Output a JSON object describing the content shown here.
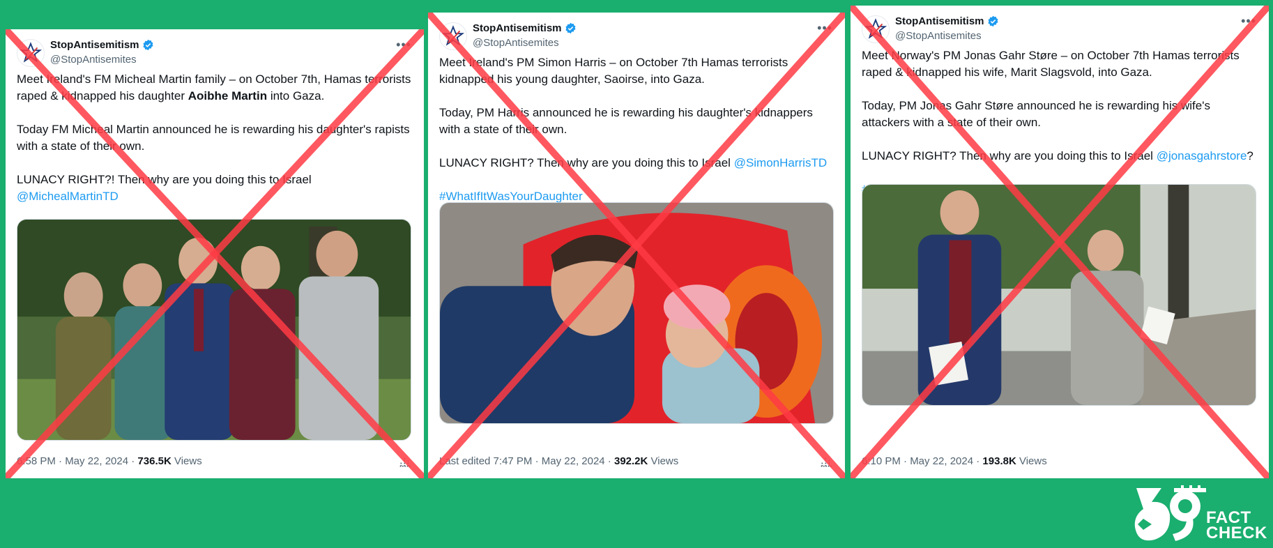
{
  "colors": {
    "background": "#1aae6f",
    "cross": "#ff3b45",
    "link": "#1d9bf0"
  },
  "tweets": [
    {
      "account_name": "StopAntisemitism",
      "handle": "@StopAntisemites",
      "more_icon": "more-icon",
      "p1_a": "Meet Ireland's FM Micheal Martin family – on October 7th, Hamas terrorists raped & kidnapped his daughter ",
      "p1_bold": "Aoibhe Martin",
      "p1_b": " into Gaza.",
      "p2": "Today FM Micheal Martin announced he is rewarding his daughter's rapists with a state of their own.",
      "p3": "LUNACY RIGHT?! Then why are you doing this to Israel",
      "mention": "@MichealMartinTD",
      "hashtag": "",
      "meta_time": "6:58 PM · May 22, 2024 · ",
      "views_count": "736.5K",
      "views_label": " Views"
    },
    {
      "account_name": "StopAntisemitism",
      "handle": "@StopAntisemites",
      "more_icon": "more-icon",
      "p1": "Meet Ireland's PM Simon Harris – on October 7th Hamas terrorists kidnapped his young daughter, Saoirse, into Gaza.",
      "p2": "Today, PM Harris announced he is rewarding his daughter's kidnappers with a state of their own.",
      "p3": "LUNACY RIGHT? Then why are you doing this to Israel ",
      "mention": "@SimonHarrisTD",
      "hashtag": "#WhatIfItWasYourDaughter",
      "meta_time": "Last edited 7:47 PM · May 22, 2024 · ",
      "views_count": "392.2K",
      "views_label": " Views"
    },
    {
      "account_name": "StopAntisemitism",
      "handle": "@StopAntisemites",
      "more_icon": "more-icon",
      "p1": "Meet Norway's PM Jonas Gahr Støre – on October 7th Hamas terrorists raped & kidnapped his wife, Marit Slagsvold, into Gaza.",
      "p2": "Today, PM Jonas Gahr Støre announced he is rewarding his wife's attackers with a state of their own.",
      "p3": "LUNACY RIGHT? Then why are you doing this to Israel ",
      "mention": "@jonasgahrstore",
      "mention_suffix": "?",
      "hashtag": "#WhatIfItWasYourWife",
      "meta_time": "6:10 PM · May 22, 2024 · ",
      "views_count": "193.8K",
      "views_label": " Views"
    }
  ],
  "logo": {
    "line1": "FACT",
    "line2": "CHECK"
  }
}
